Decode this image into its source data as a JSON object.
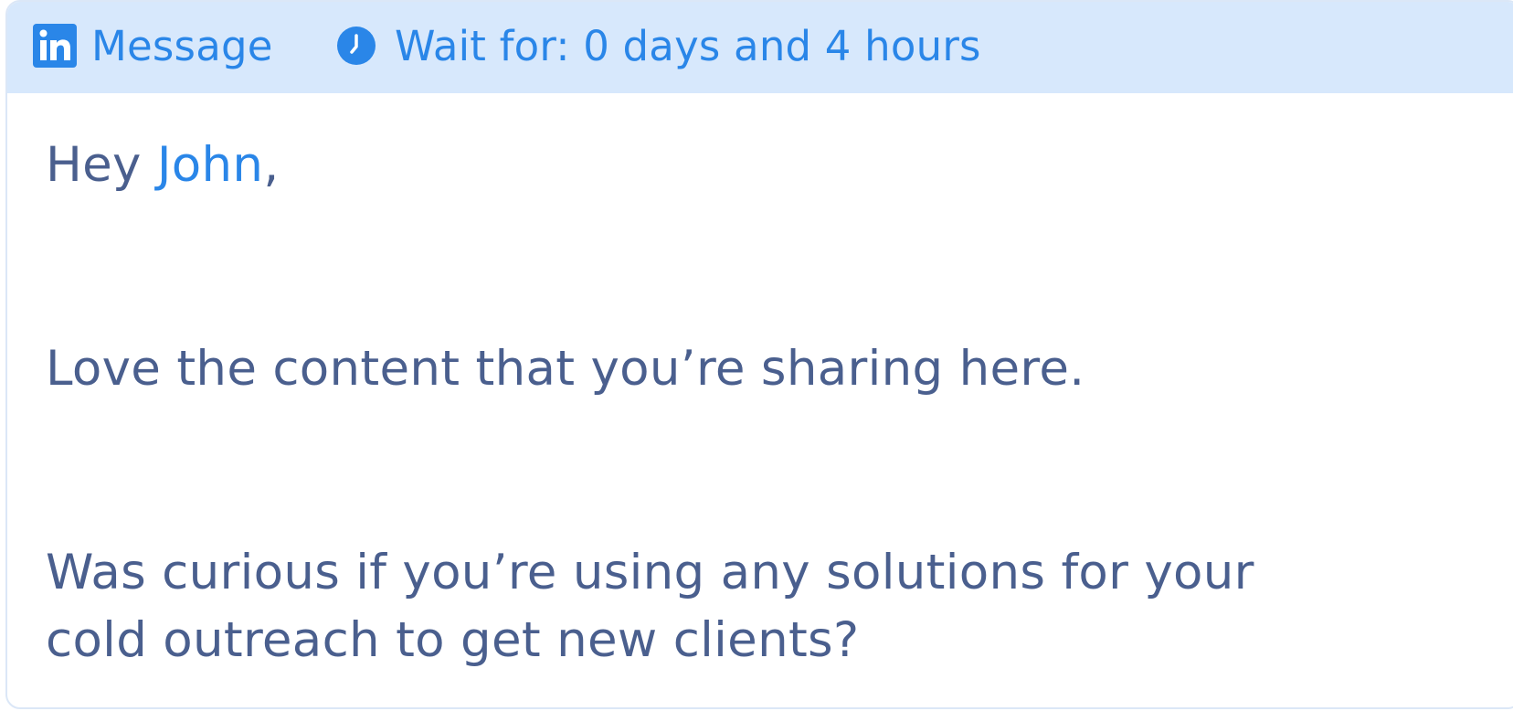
{
  "header": {
    "action_label": "Message",
    "action_icon": "linkedin-icon",
    "wait_label": "Wait for: 0 days and 4 hours",
    "wait_icon": "clock-icon",
    "accent_color": "#2a86e8",
    "header_bg": "#d7e8fc"
  },
  "message": {
    "greeting_prefix": "Hey ",
    "first_name": "John",
    "greeting_suffix": ",",
    "line2": "Love the content that you’re sharing here.",
    "line3": "Was curious if you’re using any solutions for your",
    "line4": "cold outreach to get new clients?",
    "text_color": "#4a5f8e"
  }
}
